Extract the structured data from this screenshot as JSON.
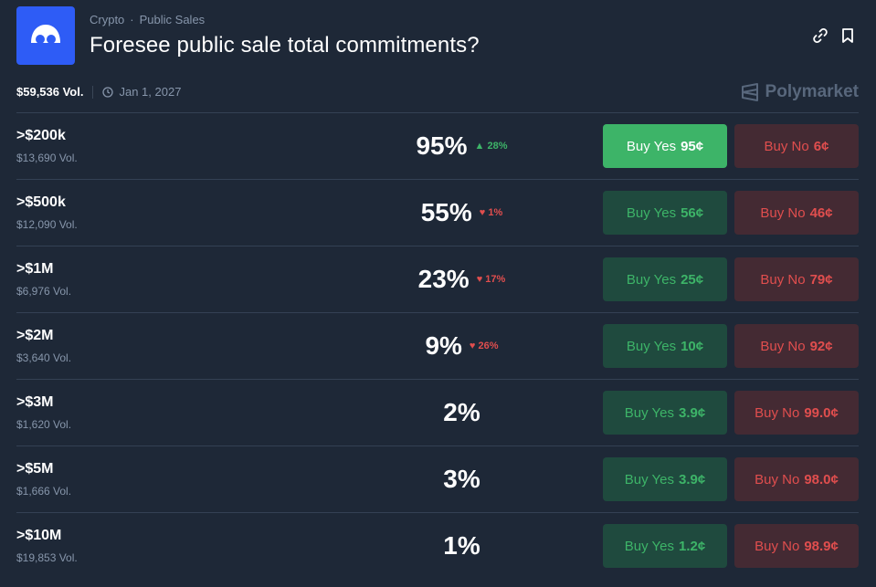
{
  "header": {
    "breadcrumb": [
      "Crypto",
      "Public Sales"
    ],
    "breadcrumb_sep": "·",
    "title": "Foresee public sale total commitments?"
  },
  "meta": {
    "volume": "$59,536 Vol.",
    "end_date": "Jan 1, 2027"
  },
  "brand": "Polymarket",
  "colors": {
    "background": "#1e2837",
    "logo": "#2e5cf6",
    "green": "#3db468",
    "red": "#e04e4e"
  },
  "outcomes": [
    {
      "label": ">$200k",
      "volume": "$13,690 Vol.",
      "chance": "95%",
      "change": "28%",
      "direction": "up",
      "yes_label": "Buy Yes",
      "yes_price": "95¢",
      "no_label": "Buy No",
      "no_price": "6¢"
    },
    {
      "label": ">$500k",
      "volume": "$12,090 Vol.",
      "chance": "55%",
      "change": "1%",
      "direction": "down",
      "yes_label": "Buy Yes",
      "yes_price": "56¢",
      "no_label": "Buy No",
      "no_price": "46¢"
    },
    {
      "label": ">$1M",
      "volume": "$6,976 Vol.",
      "chance": "23%",
      "change": "17%",
      "direction": "down",
      "yes_label": "Buy Yes",
      "yes_price": "25¢",
      "no_label": "Buy No",
      "no_price": "79¢"
    },
    {
      "label": ">$2M",
      "volume": "$3,640 Vol.",
      "chance": "9%",
      "change": "26%",
      "direction": "down",
      "yes_label": "Buy Yes",
      "yes_price": "10¢",
      "no_label": "Buy No",
      "no_price": "92¢"
    },
    {
      "label": ">$3M",
      "volume": "$1,620 Vol.",
      "chance": "2%",
      "change": "",
      "direction": "",
      "yes_label": "Buy Yes",
      "yes_price": "3.9¢",
      "no_label": "Buy No",
      "no_price": "99.0¢"
    },
    {
      "label": ">$5M",
      "volume": "$1,666 Vol.",
      "chance": "3%",
      "change": "",
      "direction": "",
      "yes_label": "Buy Yes",
      "yes_price": "3.9¢",
      "no_label": "Buy No",
      "no_price": "98.0¢"
    },
    {
      "label": ">$10M",
      "volume": "$19,853 Vol.",
      "chance": "1%",
      "change": "",
      "direction": "",
      "yes_label": "Buy Yes",
      "yes_price": "1.2¢",
      "no_label": "Buy No",
      "no_price": "98.9¢"
    }
  ]
}
